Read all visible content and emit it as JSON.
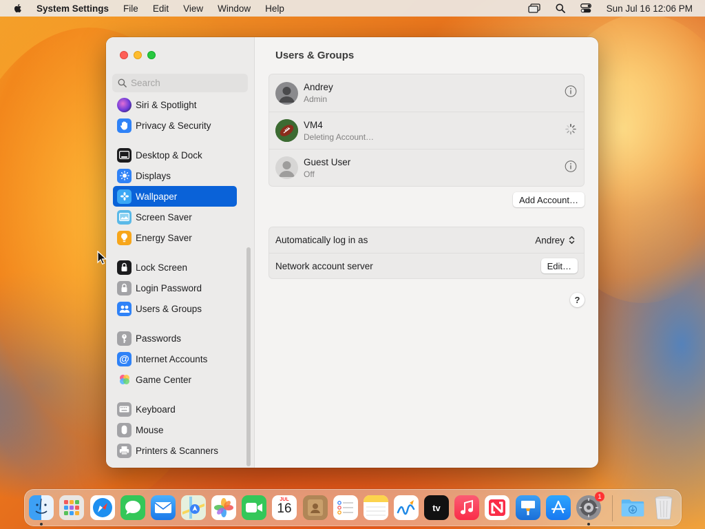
{
  "menubar": {
    "app_name": "System Settings",
    "items": [
      "File",
      "Edit",
      "View",
      "Window",
      "Help"
    ],
    "clock": "Sun Jul 16  12:06 PM"
  },
  "sidebar": {
    "search_placeholder": "Search",
    "items": [
      {
        "label": "Siri & Spotlight",
        "icon": "siri-icon"
      },
      {
        "label": "Privacy & Security",
        "icon": "hand-icon"
      },
      {
        "label": "Desktop & Dock",
        "icon": "dock-icon"
      },
      {
        "label": "Displays",
        "icon": "sun-icon"
      },
      {
        "label": "Wallpaper",
        "icon": "wallpaper-icon",
        "selected": true
      },
      {
        "label": "Screen Saver",
        "icon": "screen-saver-icon"
      },
      {
        "label": "Energy Saver",
        "icon": "bulb-icon"
      },
      {
        "label": "Lock Screen",
        "icon": "lock-icon"
      },
      {
        "label": "Login Password",
        "icon": "login-lock-icon"
      },
      {
        "label": "Users & Groups",
        "icon": "users-icon"
      },
      {
        "label": "Passwords",
        "icon": "key-icon"
      },
      {
        "label": "Internet Accounts",
        "icon": "at-icon"
      },
      {
        "label": "Game Center",
        "icon": "game-center-icon"
      },
      {
        "label": "Keyboard",
        "icon": "keyboard-icon"
      },
      {
        "label": "Mouse",
        "icon": "mouse-icon"
      },
      {
        "label": "Printers & Scanners",
        "icon": "printer-icon"
      }
    ]
  },
  "content": {
    "title": "Users & Groups",
    "users": [
      {
        "name": "Andrey",
        "status": "Admin",
        "action": "info"
      },
      {
        "name": "VM4",
        "status": "Deleting Account…",
        "action": "spinner"
      },
      {
        "name": "Guest User",
        "status": "Off",
        "action": "info"
      }
    ],
    "add_account_label": "Add Account…",
    "auto_login_label": "Automatically log in as",
    "auto_login_value": "Andrey",
    "network_server_label": "Network account server",
    "edit_label": "Edit…",
    "help_label": "?"
  },
  "dock": {
    "calendar_month": "JUL",
    "calendar_day": "16",
    "tv_label": "tv",
    "settings_badge": "1"
  },
  "colors": {
    "accent": "#0a62d8",
    "close": "#fe5f57",
    "minimize": "#febc2e",
    "zoom": "#28c840"
  }
}
